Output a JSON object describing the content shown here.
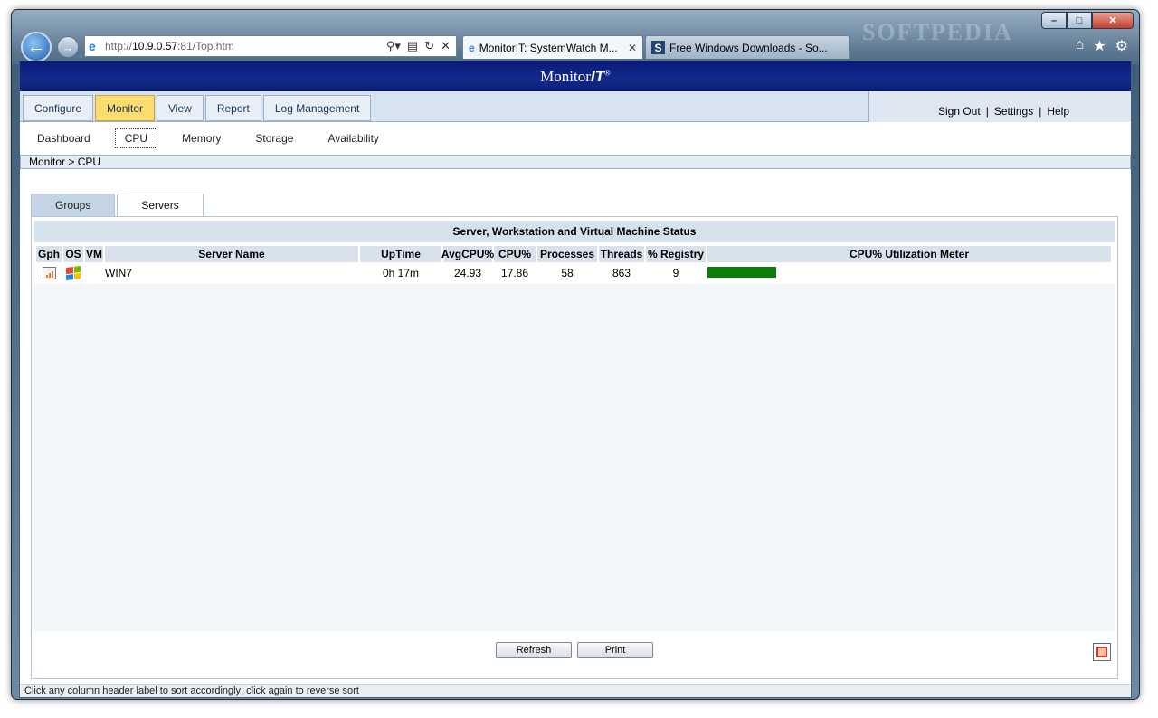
{
  "browser": {
    "url_prefix": "http://",
    "url_host": "10.9.0.57",
    "url_rest": ":81/Top.htm",
    "tabs": [
      {
        "title": "MonitorIT: SystemWatch M..."
      },
      {
        "title": "Free Windows Downloads - So..."
      }
    ],
    "watermark": "SOFTPEDIA"
  },
  "app": {
    "brand_text": "Monitor",
    "brand_suffix": "IT",
    "brand_mark": "®"
  },
  "menu": {
    "tabs": [
      "Configure",
      "Monitor",
      "View",
      "Report",
      "Log Management"
    ],
    "active": "Monitor",
    "user_links": [
      "Sign Out",
      "Settings",
      "Help"
    ],
    "separator": "|"
  },
  "submenu": {
    "items": [
      "Dashboard",
      "CPU",
      "Memory",
      "Storage",
      "Availability"
    ],
    "active": "CPU"
  },
  "breadcrumb": "Monitor > CPU",
  "view_tabs": {
    "items": [
      "Groups",
      "Servers"
    ],
    "active": "Servers"
  },
  "panel": {
    "title": "Server, Workstation and Virtual Machine Status",
    "columns": [
      "Gph",
      "OS",
      "VM",
      "Server Name",
      "UpTime",
      "AvgCPU%",
      "CPU%",
      "Processes",
      "Threads",
      "% Registry",
      "CPU% Utilization Meter"
    ],
    "rows": [
      {
        "server_name": "WIN7",
        "uptime": "0h 17m",
        "avg_cpu": "24.93",
        "cpu": "17.86",
        "processes": "58",
        "threads": "863",
        "registry": "9",
        "meter_fraction": 0.1786
      }
    ],
    "buttons": {
      "refresh": "Refresh",
      "print": "Print"
    }
  },
  "status_text": "Click any column header label to sort accordingly; click again to reverse sort",
  "colors": {
    "header_bg": "#0a1a78",
    "active_menu": "#fbdc6e",
    "meter": "#0a7d0a"
  },
  "icons": [
    "back-arrow-icon",
    "forward-arrow-icon",
    "ie-icon",
    "search-icon",
    "refresh-icon",
    "stop-icon",
    "home-icon",
    "favorites-star-icon",
    "gear-icon",
    "graph-icon",
    "windows-logo-icon",
    "export-icon"
  ]
}
